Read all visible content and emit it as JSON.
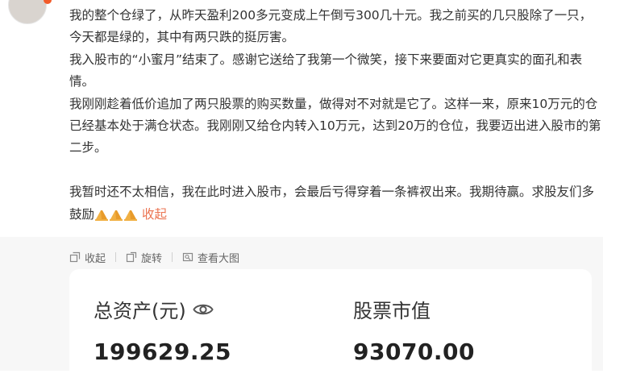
{
  "post": {
    "paragraph1": "我的整个仓绿了，从昨天盈利200多元变成上午倒亏300几十元。我之前买的几只股除了一只，今天都是绿的，其中有两只跌的挺厉害。",
    "paragraph2": "我入股市的“小蜜月”结束了。感谢它送给了我第一个微笑，接下来要面对它更真实的面孔和表情。",
    "paragraph3": "我刚刚趁着低价追加了两只股票的购买数量，做得对不对就是它了。这样一来，原来10万元的仓已经基本处于满仓状态。我刚刚又给仓内转入10万元，达到20万的仓位，我要迈出进入股市的第二步。",
    "paragraph4": "我暂时还不太相信，我在此时进入股市，会最后亏得穿着一条裤衩出来。我期待赢。求股友们多鼓励",
    "emoji_icon": "praying-hands-emoji",
    "collapse_label": "收起"
  },
  "toolbar": {
    "collapse_label": "收起",
    "rotate_label": "旋转",
    "view_large_label": "查看大图"
  },
  "account": {
    "total_assets_label": "总资产(元)",
    "total_assets_value": "199629.25",
    "stock_value_label": "股票市值",
    "stock_value_value": "93070.00"
  },
  "colors": {
    "link": "#eb7350",
    "gallery_background": "#f7f7f7"
  }
}
